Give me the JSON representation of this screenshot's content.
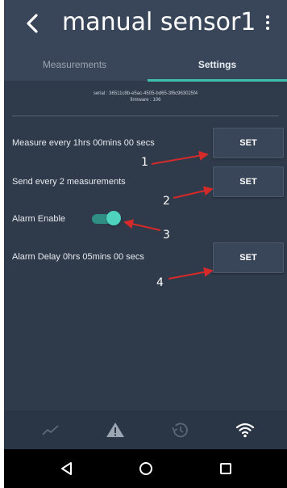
{
  "header": {
    "title": "manual sensor1",
    "back_icon": "back-arrow-icon",
    "menu_icon": "more-vert-icon"
  },
  "tabs": [
    {
      "label": "Measurements",
      "active": false
    },
    {
      "label": "Settings",
      "active": true
    }
  ],
  "device": {
    "serial": "serial : 36511c8b-e5ac-4505-bd65-3f6c963025f4",
    "firmware": "firmware : 106"
  },
  "settings": {
    "measure_every": {
      "label": "Measure every 1hrs 00mins 00 secs",
      "button": "SET",
      "annotation": "1"
    },
    "send_every": {
      "label": "Send every 2 measurements",
      "button": "SET",
      "annotation": "2"
    },
    "alarm_enable": {
      "label": "Alarm Enable",
      "enabled": true,
      "annotation": "3"
    },
    "alarm_delay": {
      "label": "Alarm Delay 0hrs 05mins 00 secs",
      "button": "SET",
      "annotation": "4"
    }
  },
  "bottom_bar": [
    "chart-icon",
    "warning-icon",
    "history-icon",
    "wifi-icon"
  ],
  "nav_bar": [
    "back-triangle-icon",
    "home-circle-icon",
    "recents-square-icon"
  ],
  "colors": {
    "background": "#2f3a4b",
    "header": "#394659",
    "accent": "#3fbfae",
    "annotation_arrow": "#d42a2a"
  }
}
